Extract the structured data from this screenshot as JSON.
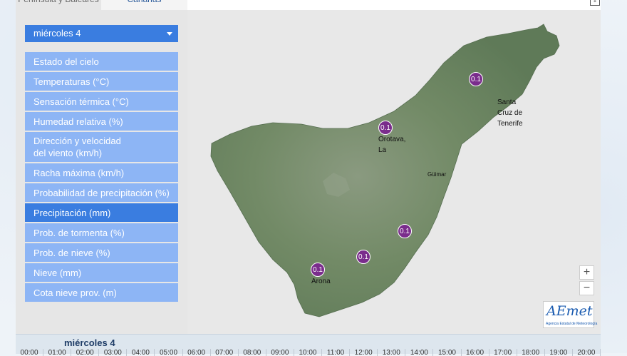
{
  "tabs": [
    "Península y Baleares",
    "Canarias"
  ],
  "day_select": {
    "value": "miércoles 4"
  },
  "menu": [
    {
      "label": "Estado del cielo",
      "active": false
    },
    {
      "label": "Temperaturas (°C)",
      "active": false
    },
    {
      "label": "Sensación térmica (°C)",
      "active": false
    },
    {
      "label": "Humedad relativa (%)",
      "active": false
    },
    {
      "label": "Dirección y velocidad del viento (km/h)",
      "active": false
    },
    {
      "label": "Racha máxima (km/h)",
      "active": false
    },
    {
      "label": "Probabilidad de precipitación (%)",
      "active": false
    },
    {
      "label": "Precipitación (mm)",
      "active": true
    },
    {
      "label": "Prob. de tormenta (%)",
      "active": false
    },
    {
      "label": "Prob. de nieve (%)",
      "active": false
    },
    {
      "label": "Nieve (mm)",
      "active": false
    },
    {
      "label": "Cota nieve prov. (m)",
      "active": false
    }
  ],
  "markers": [
    "0.1",
    "0.1",
    "0.1",
    "0.1",
    "0.1"
  ],
  "places": {
    "santa_cruz": [
      "Santa",
      "Cruz de",
      "Tenerife"
    ],
    "orotava": [
      "Orotava,",
      "La"
    ],
    "guimar": "Güimar",
    "arona": "Arona"
  },
  "zoom": {
    "in": "+",
    "out": "−"
  },
  "logo": {
    "word": "AEmet",
    "sub": "Agencia Estatal de Meteorología"
  },
  "timeline": {
    "day": "miércoles 4",
    "hours": [
      "00:00",
      "01:00",
      "02:00",
      "03:00",
      "04:00",
      "05:00",
      "06:00",
      "07:00",
      "08:00",
      "09:00",
      "10:00",
      "11:00",
      "12:00",
      "13:00",
      "14:00",
      "15:00",
      "16:00",
      "17:00",
      "18:00",
      "19:00",
      "20:00"
    ]
  },
  "colors": {
    "accent": "#3a7de0",
    "menu": "#8db5f5",
    "marker": "#7a2d8c",
    "terrain": "#6f8a64"
  }
}
